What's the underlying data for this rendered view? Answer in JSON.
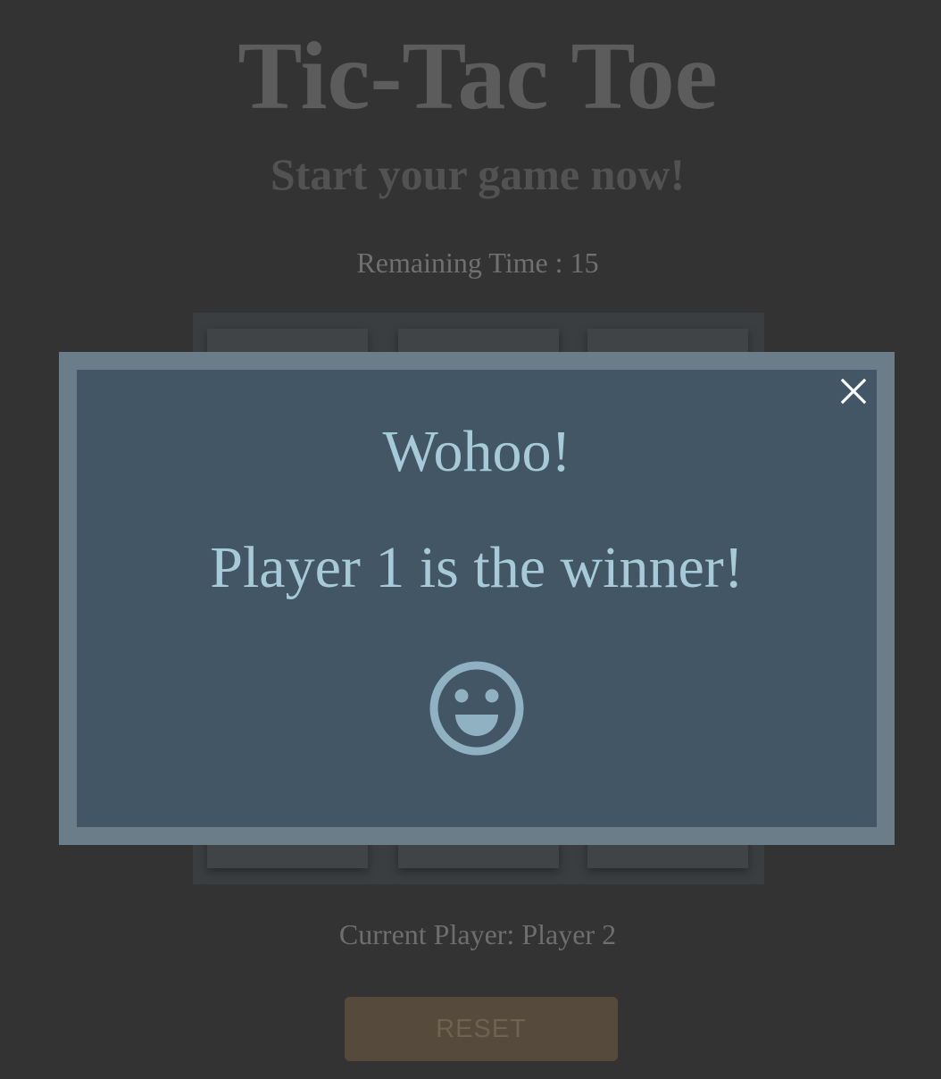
{
  "header": {
    "title": "Tic-Tac Toe",
    "subtitle": "Start your game now!"
  },
  "timer": {
    "text": "Remaining Time : 15"
  },
  "board": {
    "cells": [
      "",
      "",
      "",
      "",
      "",
      "",
      "",
      "",
      ""
    ]
  },
  "status": {
    "current_player": "Current Player: Player 2"
  },
  "controls": {
    "reset_label": "RESET"
  },
  "modal": {
    "heading": "Wohoo!",
    "message": "Player 1 is the winner!",
    "close_icon": "close-icon",
    "emoji_icon": "smiley-icon"
  },
  "colors": {
    "background": "#333333",
    "modal_border": "#6b7d89",
    "modal_fill": "#425665",
    "modal_text": "#a7cad9",
    "reset_button": "#564a3c"
  }
}
